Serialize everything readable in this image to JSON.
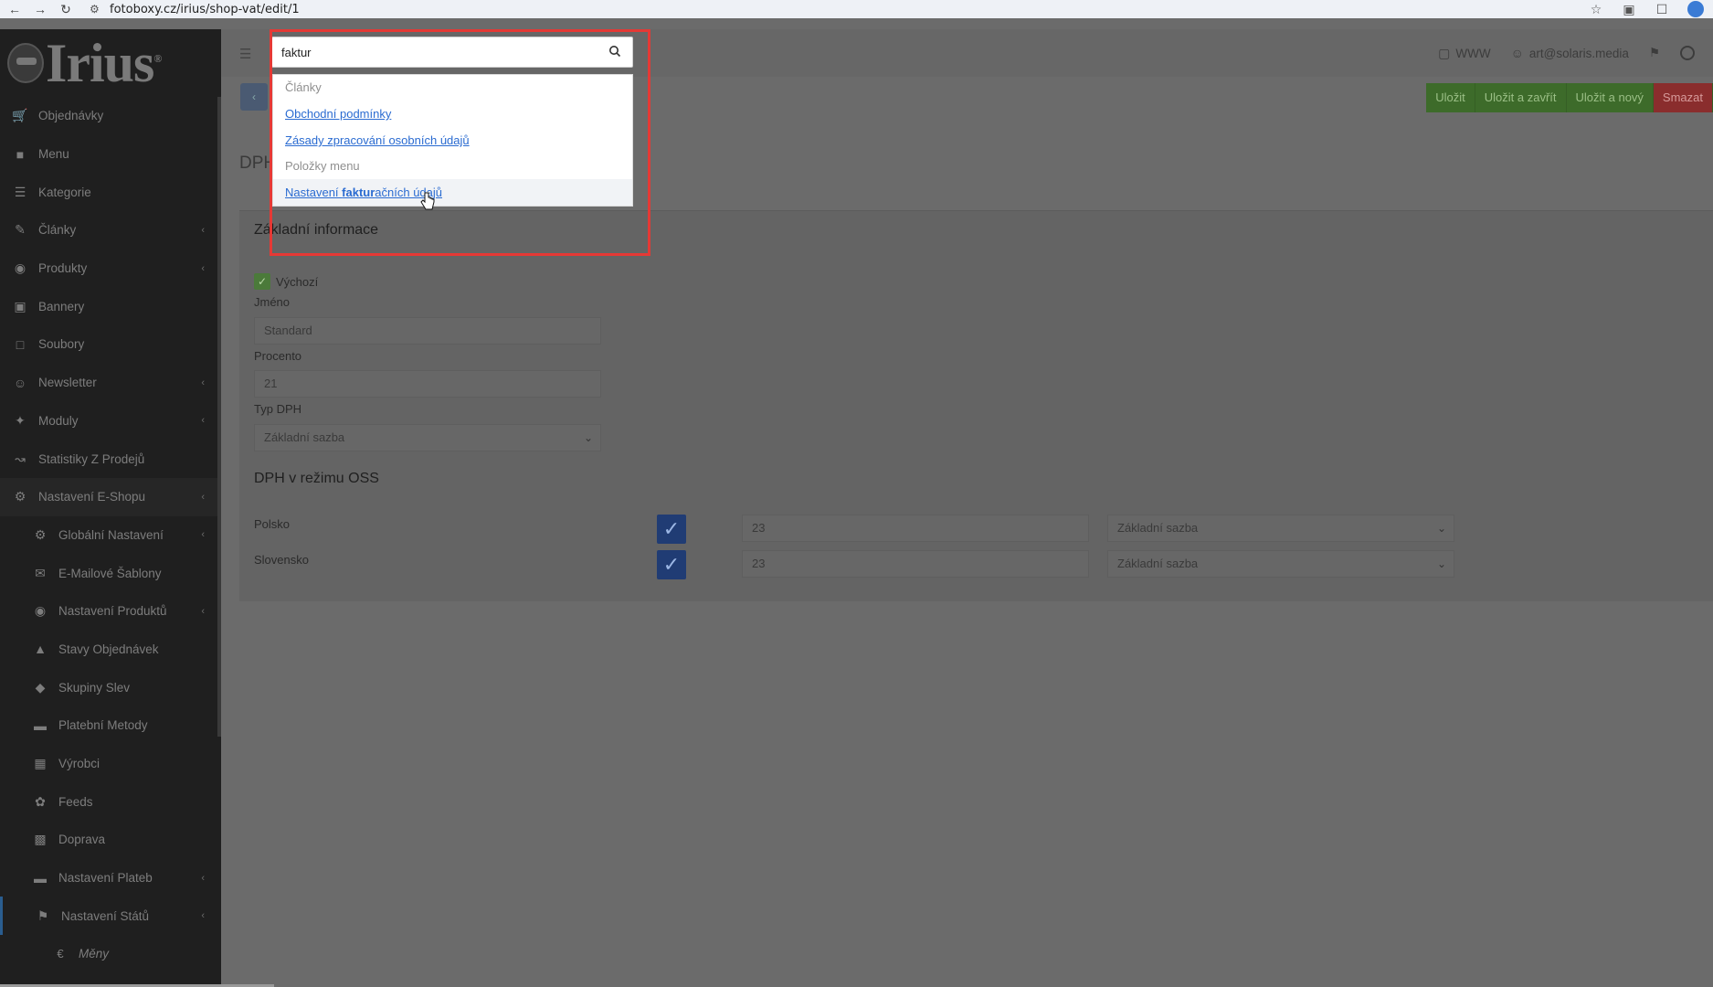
{
  "browser": {
    "url": "fotoboxy.cz/irius/shop-vat/edit/1",
    "back_icon": "arrow-left-icon",
    "forward_icon": "arrow-right-icon",
    "reload_icon": "reload-icon"
  },
  "logo": {
    "text": "Irius",
    "mark": "®"
  },
  "sidebar": {
    "items": [
      {
        "label": "Objednávky",
        "icon": "cart-icon"
      },
      {
        "label": "Menu",
        "icon": "folder-icon"
      },
      {
        "label": "Kategorie",
        "icon": "list-icon"
      },
      {
        "label": "Články",
        "icon": "pencil-icon",
        "expandable": true
      },
      {
        "label": "Produkty",
        "icon": "globe-icon",
        "expandable": true
      },
      {
        "label": "Bannery",
        "icon": "image-icon"
      },
      {
        "label": "Soubory",
        "icon": "file-icon"
      },
      {
        "label": "Newsletter",
        "icon": "smile-icon",
        "expandable": true
      },
      {
        "label": "Moduly",
        "icon": "puzzle-icon",
        "expandable": true
      },
      {
        "label": "Statistiky Z Prodejů",
        "icon": "chart-icon"
      },
      {
        "label": "Nastavení E-Shopu",
        "icon": "settings-icon",
        "expandable": true
      },
      {
        "label": "Globální Nastavení",
        "icon": "gear-icon",
        "expandable": true
      },
      {
        "label": "E-Mailové Šablony",
        "icon": "envelope-icon"
      },
      {
        "label": "Nastavení Produktů",
        "icon": "globe-icon",
        "expandable": true
      },
      {
        "label": "Stavy Objednávek",
        "icon": "warning-icon"
      },
      {
        "label": "Skupiny Slev",
        "icon": "tag-icon"
      },
      {
        "label": "Platební Metody",
        "icon": "card-icon"
      },
      {
        "label": "Výrobci",
        "icon": "building-icon"
      },
      {
        "label": "Feeds",
        "icon": "rss-icon"
      },
      {
        "label": "Doprava",
        "icon": "truck-icon"
      },
      {
        "label": "Nastavení Plateb",
        "icon": "card-icon",
        "expandable": true
      },
      {
        "label": "Nastavení Států",
        "icon": "flag-icon",
        "expandable": true
      },
      {
        "label": "Měny",
        "icon": "euro-icon"
      }
    ]
  },
  "header": {
    "www_label": "WWW",
    "user_email": "art@solaris.media"
  },
  "actions": {
    "save": "Uložit",
    "save_close": "Uložit a zavřít",
    "save_new": "Uložit a nový",
    "delete": "Smazat"
  },
  "page": {
    "title": "DPH"
  },
  "form": {
    "section_basic": "Základní informace",
    "default_label": "Výchozí",
    "name_label": "Jméno",
    "name_value": "Standard",
    "percent_label": "Procento",
    "percent_value": "21",
    "type_label": "Typ DPH",
    "type_value": "Základní sazba",
    "section_oss": "DPH v režimu OSS",
    "oss_rows": [
      {
        "country": "Polsko",
        "rate": "23",
        "type": "Základní sazba"
      },
      {
        "country": "Slovensko",
        "rate": "23",
        "type": "Základní sazba"
      }
    ]
  },
  "search": {
    "value": "faktur",
    "groups": [
      {
        "title": "Články",
        "links": [
          "Obchodní podmínky",
          "Zásady zpracování osobních údajů"
        ]
      },
      {
        "title": "Položky menu",
        "links": [
          "Nastavení fakturačních údajů"
        ]
      }
    ],
    "highlight_prefix": "Nastavení ",
    "highlight_match": "faktur",
    "highlight_suffix": "ačních údajů"
  },
  "colors": {
    "save_button": "#3d6b2a",
    "delete_button": "#8a2d2d",
    "link": "#2a6bd1",
    "annotation_frame": "#e53935"
  }
}
